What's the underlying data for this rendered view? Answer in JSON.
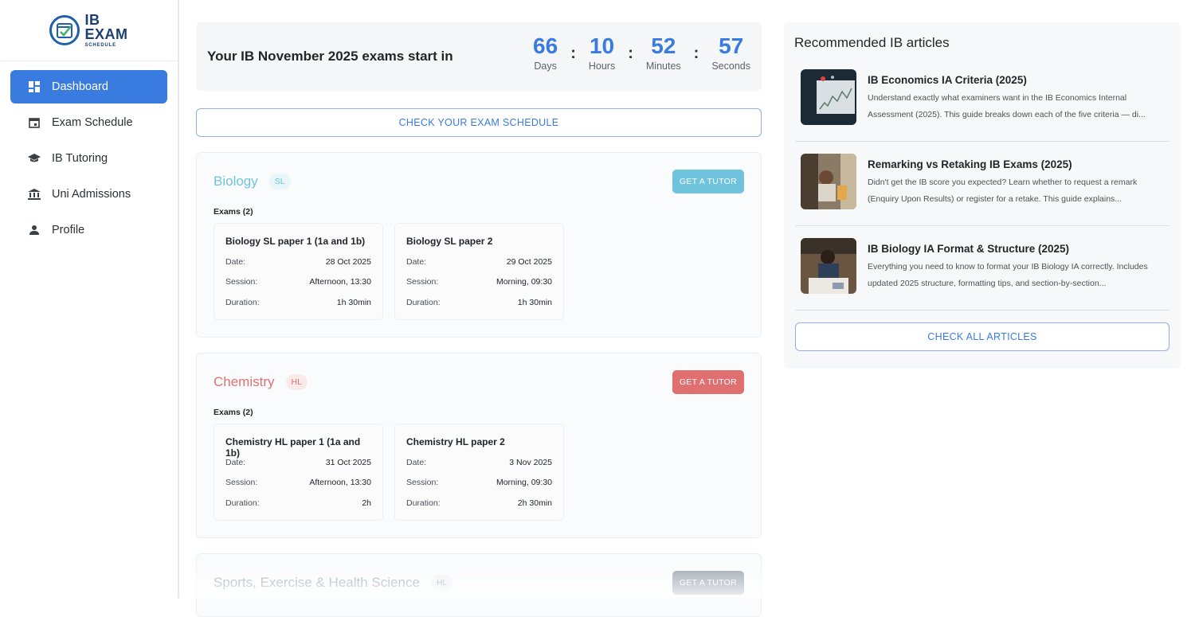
{
  "logo": {
    "line1": "IB",
    "line2": "EXAM",
    "line3": "SCHEDULE"
  },
  "sidebar": {
    "items": [
      {
        "label": "Dashboard",
        "icon": "dashboard-icon"
      },
      {
        "label": "Exam Schedule",
        "icon": "calendar-icon"
      },
      {
        "label": "IB Tutoring",
        "icon": "graduation-cap-icon"
      },
      {
        "label": "Uni Admissions",
        "icon": "institution-icon"
      },
      {
        "label": "Profile",
        "icon": "person-icon"
      }
    ]
  },
  "countdown": {
    "title": "Your IB November 2025 exams start in",
    "days": "66",
    "days_label": "Days",
    "hours": "10",
    "hours_label": "Hours",
    "minutes": "52",
    "minutes_label": "Minutes",
    "seconds": "57",
    "seconds_label": "Seconds",
    "separator": ":"
  },
  "schedule_button": "CHECK YOUR EXAM SCHEDULE",
  "subjects": [
    {
      "name": "Biology",
      "level": "SL",
      "tutor_button": "GET A TUTOR",
      "exams_count": "Exams (2)",
      "color": "#6fc3dd",
      "exams": [
        {
          "title": "Biology SL paper 1 (1a and 1b)",
          "date_label": "Date:",
          "date": "28 Oct 2025",
          "session_label": "Session:",
          "session": "Afternoon, 13:30",
          "duration_label": "Duration:",
          "duration": "1h 30min"
        },
        {
          "title": "Biology SL paper 2",
          "date_label": "Date:",
          "date": "29 Oct 2025",
          "session_label": "Session:",
          "session": "Morning, 09:30",
          "duration_label": "Duration:",
          "duration": "1h 30min"
        }
      ]
    },
    {
      "name": "Chemistry",
      "level": "HL",
      "tutor_button": "GET A TUTOR",
      "exams_count": "Exams (2)",
      "color": "#e07070",
      "exams": [
        {
          "title": "Chemistry HL paper 1 (1a and 1b)",
          "date_label": "Date:",
          "date": "31 Oct 2025",
          "session_label": "Session:",
          "session": "Afternoon, 13:30",
          "duration_label": "Duration:",
          "duration": "2h"
        },
        {
          "title": "Chemistry HL paper 2",
          "date_label": "Date:",
          "date": "3 Nov 2025",
          "session_label": "Session:",
          "session": "Morning, 09:30",
          "duration_label": "Duration:",
          "duration": "2h 30min"
        }
      ]
    },
    {
      "name": "Sports, Exercise & Health Science",
      "level": "HL",
      "tutor_button": "GET A TUTOR",
      "color": "#8e99a6"
    }
  ],
  "articles": {
    "heading": "Recommended IB articles",
    "items": [
      {
        "title": "IB Economics IA Criteria (2025)",
        "desc": "Understand exactly what examiners want in the IB Economics Internal Assessment (2025). This guide breaks down each of the five criteria — di..."
      },
      {
        "title": "Remarking vs Retaking IB Exams (2025)",
        "desc": "Didn't get the IB score you expected? Learn whether to request a remark (Enquiry Upon Results) or register for a retake. This guide explains..."
      },
      {
        "title": "IB Biology IA Format & Structure (2025)",
        "desc": "Everything you need to know to format your IB Biology IA correctly. Includes updated 2025 structure, formatting tips, and section-by-section..."
      }
    ],
    "button": "CHECK ALL ARTICLES"
  },
  "colors": {
    "accent": "#3a7be0",
    "biology": "#6fc3dd",
    "chemistry": "#e07070",
    "sehs": "#8e99a6"
  }
}
